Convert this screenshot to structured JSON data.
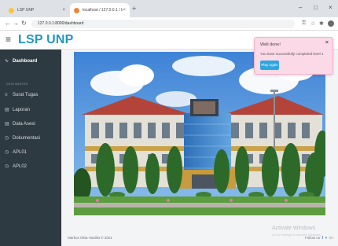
{
  "browser": {
    "tab1_title": "LSP UNP",
    "tab2_title": "localhost / 127.0.0.1 / lsp / api / ...",
    "url": "127.0.0.1:8000/dashboard",
    "minimize": "–",
    "maximize": "□",
    "close": "×",
    "new_tab": "+"
  },
  "header": {
    "menu_icon": "≡",
    "brand": "LSP UNP"
  },
  "sidebar": {
    "dashboard": "Dashboard",
    "section_heading": "DATA MASTER",
    "items": [
      {
        "icon": "≡",
        "label": "Surat Tugas"
      },
      {
        "icon": "▤",
        "label": "Laporan"
      },
      {
        "icon": "▤",
        "label": "Data Asesi"
      },
      {
        "icon": "◷",
        "label": "Dokumentasi"
      },
      {
        "icon": "◷",
        "label": "APL01"
      },
      {
        "icon": "◷",
        "label": "APL02"
      }
    ]
  },
  "toast": {
    "title": "Well done!",
    "message": "You have successfully completed level 1",
    "button": "Play Again"
  },
  "footer": {
    "copyright": "Markus Okta Hardila © 2021",
    "follow": "Follow us"
  },
  "watermark": {
    "line1": "Activate Windows",
    "line2": "Go to Settings to activate Windows."
  }
}
